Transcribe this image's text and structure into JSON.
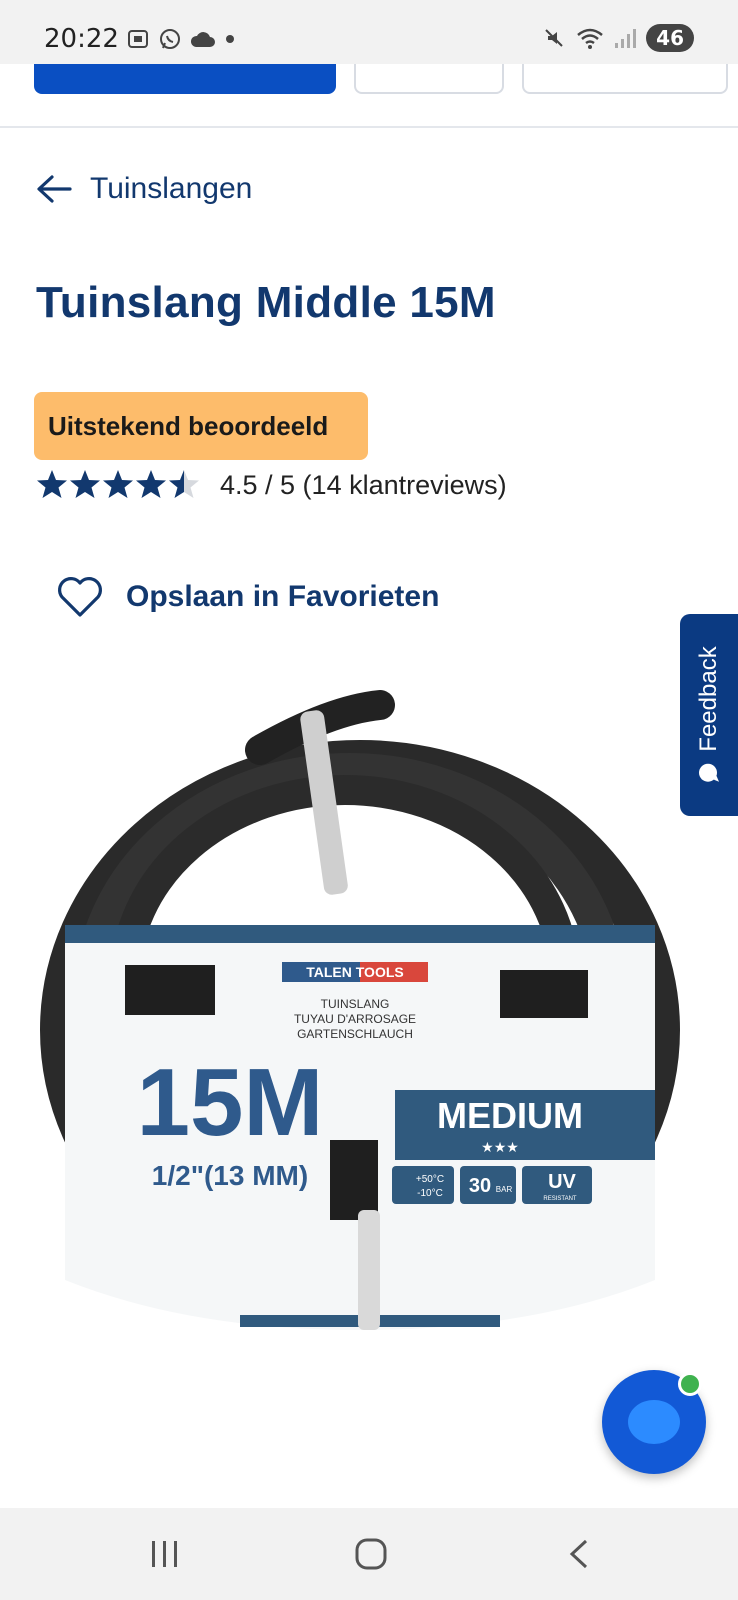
{
  "status_bar": {
    "time": "20:22",
    "battery": "46",
    "icons_left": [
      "screenshot-icon",
      "whatsapp-icon",
      "cloud-icon",
      "dot-icon"
    ],
    "icons_right": [
      "mute-icon",
      "wifi-icon",
      "signal-icon",
      "battery-icon"
    ]
  },
  "breadcrumb": {
    "back_label": "Tuinslangen"
  },
  "product": {
    "title": "Tuinslang Middle 15M",
    "badge": "Uitstekend beoordeeld",
    "rating_value": 4.5,
    "rating_max": 5,
    "rating_text": "4.5 / 5 (14 klantreviews)",
    "favorite_label": "Opslaan in Favorieten"
  },
  "product_image": {
    "brand": "TALEN TOOLS",
    "lines": [
      "TUINSLANG",
      "TUYAU D'ARROSAGE",
      "GARTENSCHLAUCH"
    ],
    "length": "15M",
    "diameter": "1/2\"(13 MM)",
    "grade": "MEDIUM",
    "grade_stars": "★★★",
    "temp_high": "+50°C",
    "temp_low": "-10°C",
    "pressure": "30",
    "pressure_unit": "BAR",
    "uv": "UV",
    "uv_sub": "RESISTANT"
  },
  "feedback_tab": {
    "label": "Feedback"
  },
  "colors": {
    "navy": "#12386e",
    "blue": "#0a4fc2",
    "badge": "#fdbc6b",
    "feedback": "#0b3a82"
  }
}
